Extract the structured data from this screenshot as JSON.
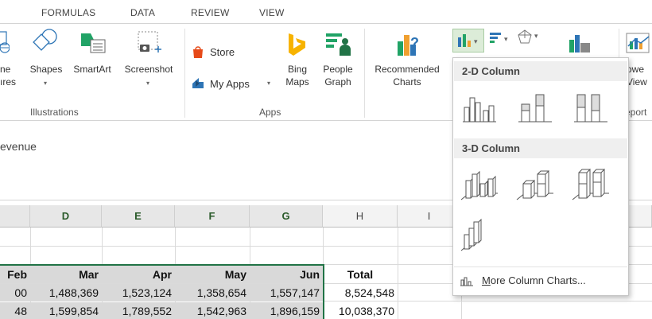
{
  "tabs": [
    "FORMULAS",
    "DATA",
    "REVIEW",
    "VIEW"
  ],
  "ribbon": {
    "online_pictures_label_1": "ne",
    "online_pictures_label_2": "ıres",
    "shapes_label": "Shapes",
    "smartart_label": "SmartArt",
    "screenshot_label": "Screenshot",
    "illustrations_group": "Illustrations",
    "store_label": "Store",
    "my_apps_label": "My Apps",
    "bing_maps_label_1": "Bing",
    "bing_maps_label_2": "Maps",
    "people_graph_label_1": "People",
    "people_graph_label_2": "Graph",
    "apps_group": "Apps",
    "recommended_charts_label_1": "Recommended",
    "recommended_charts_label_2": "Charts",
    "power_view_label_1": "owe",
    "power_view_label_2": "View",
    "reports_group": "eport"
  },
  "textbox": {
    "text": "evenue"
  },
  "sheet": {
    "columns": [
      "D",
      "E",
      "F",
      "G",
      "H",
      "I"
    ],
    "header_row": [
      "Feb",
      "Mar",
      "Apr",
      "May",
      "Jun",
      "Total"
    ],
    "row1": [
      "00",
      "1,488,369",
      "1,523,124",
      "1,358,654",
      "1,557,147",
      "8,524,548"
    ],
    "row2": [
      "48",
      "1,599,854",
      "1,789,552",
      "1,542,963",
      "1,896,159",
      "10,038,370"
    ]
  },
  "dropdown": {
    "section1": "2-D Column",
    "section2": "3-D Column",
    "more_prefix": "M",
    "more_rest": "ore Column Charts...",
    "items_2d": [
      "clustered-column",
      "stacked-column",
      "100-stacked-column"
    ],
    "items_3d": [
      "3d-clustered-column",
      "3d-stacked-column",
      "3d-100-stacked-column",
      "3d-column"
    ]
  },
  "colors": {
    "excel_green": "#217346",
    "header_grey": "#d9d9d9",
    "highlight": "#dcecd8"
  }
}
